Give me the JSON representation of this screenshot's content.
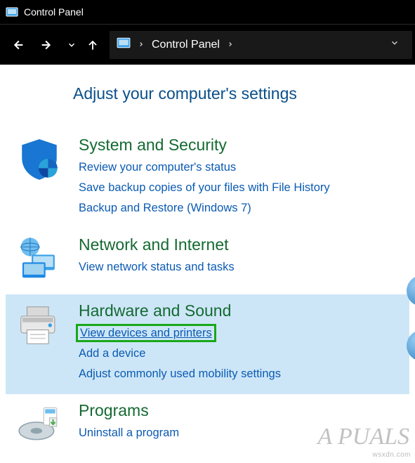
{
  "titlebar": {
    "title": "Control Panel"
  },
  "navbar": {
    "breadcrumb": "Control Panel"
  },
  "heading": "Adjust your computer's settings",
  "categories": {
    "system": {
      "title": "System and Security",
      "links": {
        "review": "Review your computer's status",
        "backup": "Save backup copies of your files with File History",
        "restore": "Backup and Restore (Windows 7)"
      }
    },
    "network": {
      "title": "Network and Internet",
      "links": {
        "status": "View network status and tasks"
      }
    },
    "hardware": {
      "title": "Hardware and Sound",
      "links": {
        "devices": "View devices and printers",
        "add": "Add a device",
        "mobility": "Adjust commonly used mobility settings"
      }
    },
    "programs": {
      "title": "Programs",
      "links": {
        "uninstall": "Uninstall a program"
      }
    }
  },
  "watermark": "wsxdn.com",
  "brand": "A  PUALS"
}
